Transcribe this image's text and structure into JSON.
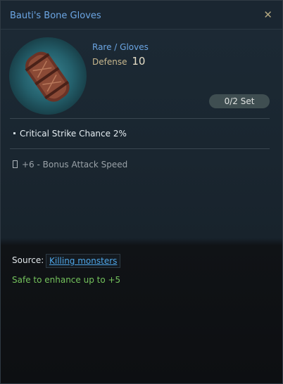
{
  "item": {
    "name": "Bauti's Bone Gloves",
    "rarity_type": "Rare / Gloves",
    "defense_label": "Defense",
    "defense_value": "10",
    "set_label": "0/2 Set",
    "stat": "Critical Strike Chance  2%",
    "bonus": "+6 - Bonus Attack Speed",
    "source_label": "Source:",
    "source_link": "Killing monsters",
    "enhance_note": "Safe to enhance up to +5"
  },
  "icons": {
    "close": "close-icon",
    "item": "leather-glove-icon",
    "bullet": "bullet-icon",
    "lock": "lock-icon"
  },
  "colors": {
    "rarity": "#6ca6e4",
    "enhance": "#74c25c",
    "link": "#4ea6e8"
  }
}
